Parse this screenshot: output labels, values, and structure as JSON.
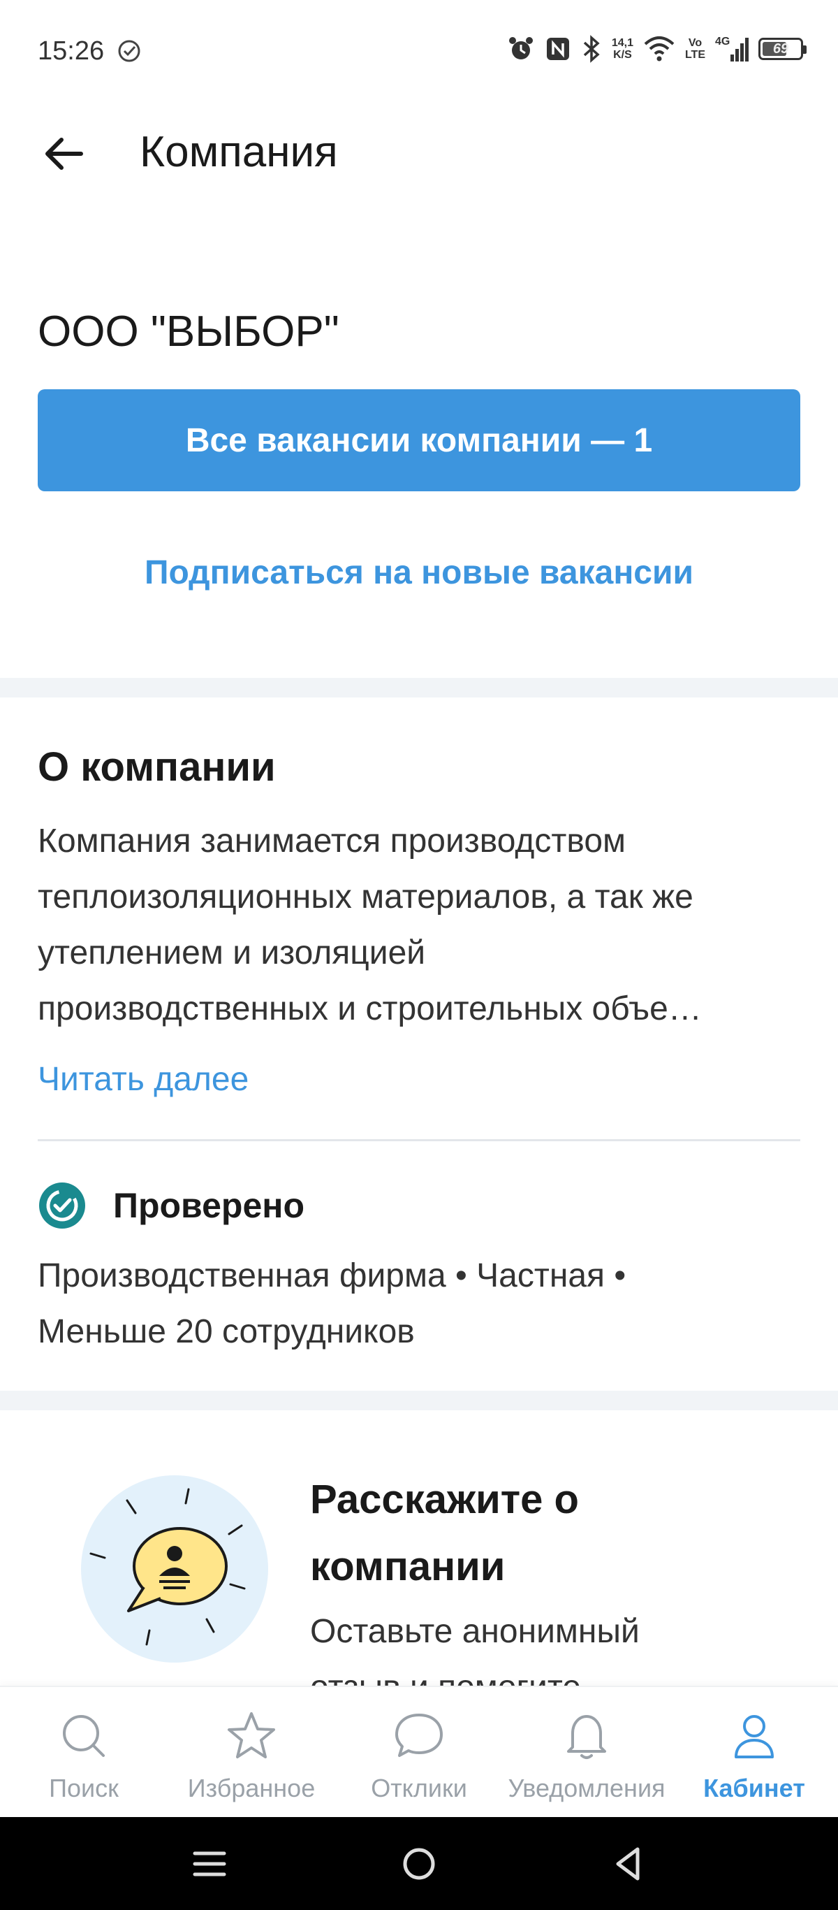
{
  "status_bar": {
    "time": "15:26",
    "net_speed_top": "14,1",
    "net_speed_bottom": "K/S",
    "volte_top": "Vo",
    "volte_bottom": "LTE",
    "network": "4G",
    "battery": "69",
    "battery_level": 0.69
  },
  "header": {
    "title": "Компания"
  },
  "company": {
    "name": "ООО \"ВЫБОР\"",
    "vacancies_button": "Все вакансии компании — 1",
    "subscribe_link": "Подписаться на новые вакансии"
  },
  "about": {
    "title": "О компании",
    "lines": [
      "Компания занимается производством",
      "теплоизоляционных материалов, а так же",
      "утеплением и изоляцией",
      "производственных и строительных объе…"
    ],
    "read_more": "Читать далее"
  },
  "verification": {
    "label": "Проверено",
    "info_lines": [
      "Производственная фирма • Частная •",
      "Меньше 20 сотрудников"
    ]
  },
  "promo": {
    "title_lines": [
      "Расскажите о",
      "компании"
    ],
    "text_lines": [
      "Оставьте анонимный",
      "отзыв и помогите"
    ]
  },
  "bottom_nav": {
    "items": [
      {
        "label": "Поиск",
        "icon": "search-icon"
      },
      {
        "label": "Избранное",
        "icon": "star-icon"
      },
      {
        "label": "Отклики",
        "icon": "chat-bubble-icon"
      },
      {
        "label": "Уведомления",
        "icon": "bell-icon"
      },
      {
        "label": "Кабинет",
        "icon": "person-icon",
        "active": true
      }
    ]
  },
  "colors": {
    "accent": "#3d95de",
    "verified": "#1a8a8f",
    "inactive": "#9aa1a8"
  }
}
